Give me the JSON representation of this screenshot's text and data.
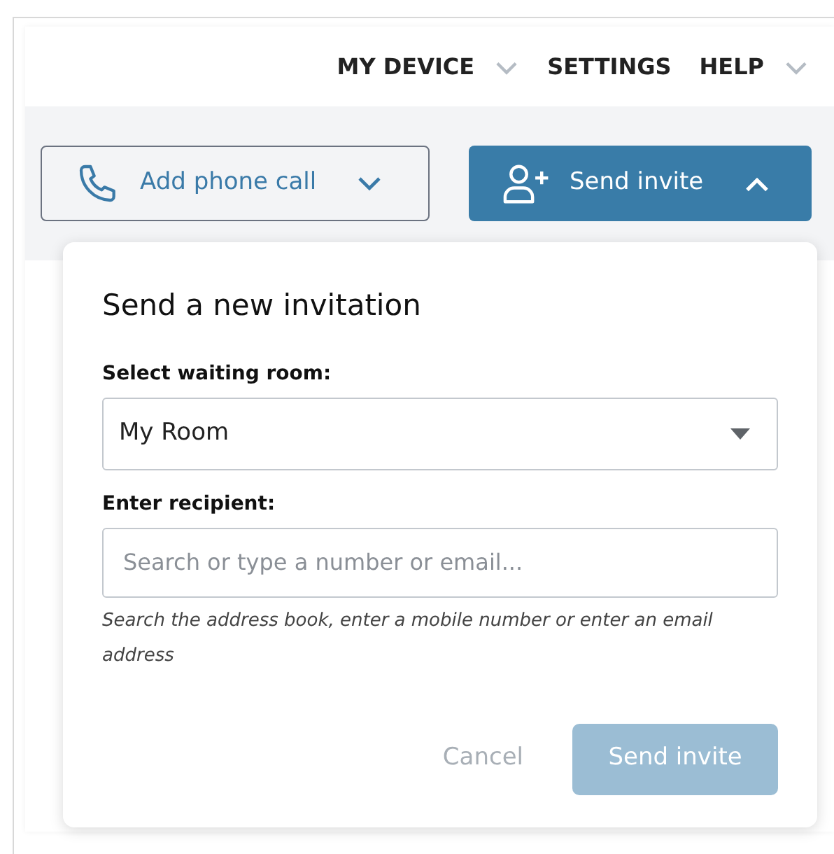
{
  "nav": [
    {
      "label": "MY DEVICE",
      "has_menu": true
    },
    {
      "label": "SETTINGS",
      "has_menu": false
    },
    {
      "label": "HELP",
      "has_menu": true
    }
  ],
  "actions": [
    {
      "label": "Add phone call",
      "kind": "outline",
      "expanded": false
    },
    {
      "label": "Send invite",
      "kind": "filled",
      "expanded": true
    }
  ],
  "popup": {
    "title": "Send a new invitation",
    "room_label": "Select waiting room:",
    "room_value": "My Room",
    "recipient_label": "Enter recipient:",
    "recipient_placeholder": "Search or type a number or email...",
    "hint": "Search the address book, enter a mobile number or enter an email address",
    "buttons": [
      {
        "label": "Cancel",
        "kind": "text",
        "disabled": true
      },
      {
        "label": "Send invite",
        "kind": "primary",
        "disabled": true
      }
    ]
  }
}
